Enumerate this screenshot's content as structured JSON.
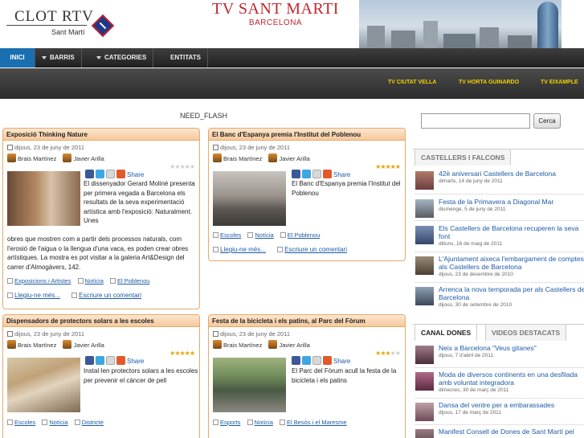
{
  "header": {
    "logo_text": "CLOT RTV",
    "logo_sub": "Sant Martí",
    "site_title": "TV SANT MARTI",
    "site_subtitle": "BARCELONA"
  },
  "nav": {
    "items": [
      {
        "label": "INICI"
      },
      {
        "label": "BARRIS"
      },
      {
        "label": "CATEGORIES"
      },
      {
        "label": "ENTITATS"
      }
    ]
  },
  "subnav": {
    "items": [
      {
        "label": "TV CIUTAT VELLA"
      },
      {
        "label": "TV HORTA GUINARDO"
      },
      {
        "label": "TV EIXAMPLE"
      }
    ]
  },
  "main": {
    "flash_text": "NEED_FLASH",
    "share_label": "Share",
    "read_more": "Llegiu-ne més...",
    "write_comment": "Escriure un comentari",
    "articles": [
      {
        "title": "Exposició Thinking Nature",
        "date": "dijous, 23 de juny de 2011",
        "authors": [
          "Brais Martínez",
          "Javier Arilla"
        ],
        "rating": 0,
        "body_right": "El dissenyador Gerard Moliné presenta per primera vegada a Barcelona els resultats de la seva experimentació artística amb l'exposició: Naturalment. Unes",
        "body_full": "obres que mostren com a partir dels processos naturals, com l'erosió de l'aigua o la llengua d'una vaca, es poden crear obres artístiques. La mostra es pot visitar a la galeria Art&Design del carrer d'Almogàvers, 142.",
        "tags": [
          "Exposicions i Artistes",
          "Notícia",
          "El Poblenou"
        ]
      },
      {
        "title": "El Banc d'Espanya premia l'Institut del Poblenou",
        "date": "dijous, 23 de juny de 2011",
        "authors": [
          "Brais Martínez",
          "Javier Arilla"
        ],
        "rating": 5,
        "body_right": "El Banc d'Espanya premia l'Institut del Poblenou",
        "body_full": "",
        "tags": [
          "Escoles",
          "Notícia",
          "El Poblenou"
        ]
      },
      {
        "title": "Dispensadors de protectors solars a les escoles",
        "date": "dijous, 23 de juny de 2011",
        "authors": [
          "Brais Martínez",
          "Javier Arilla"
        ],
        "rating": 5,
        "body_right": "Instal·len protectors solars a les escoles per prevenir el càncer de pell",
        "body_full": "",
        "tags": [
          "Escoles",
          "Notícia",
          "Districte"
        ]
      },
      {
        "title": "Festa de la bicicleta i els patins, al Parc del Fòrum",
        "date": "dijous, 23 de juny de 2011",
        "authors": [
          "Brais Martínez",
          "Javier Arilla"
        ],
        "rating": 3,
        "body_right": "El Parc del Fòrum acull la festa de la bicicleta i els patins",
        "body_full": "",
        "tags": [
          "Esports",
          "Notícia",
          "El Besòs i el Maresme"
        ]
      }
    ]
  },
  "sidebar": {
    "search_button": "Cerca",
    "search_value": "",
    "castellers_tab": "CASTELLERS I FALCONS",
    "castellers": [
      {
        "title": "42è aniversari Castellers de Barcelona",
        "date": "dimarts, 14 de juny de 2011"
      },
      {
        "title": "Festa de la Primavera a Diagonal Mar",
        "date": "diumenge, 5 de juny de 2011"
      },
      {
        "title": "Els Castellers de Barcelona recuperen la seva font",
        "date": "dilluns, 16 de maig de 2011"
      },
      {
        "title": "L'Ajuntament aixeca l'embargament de comptes als Castellers de Barcelona",
        "date": "dijous, 23 de desembre de 2010"
      },
      {
        "title": "Arrenca la nova temporada per als Castellers de Barcelona",
        "date": "dijous, 30 de setembre de 2010"
      }
    ],
    "tabs2": [
      {
        "label": "CANAL DONES"
      },
      {
        "label": "VIDEOS DESTACATS"
      }
    ],
    "dones": [
      {
        "title": "Neix a Barcelona \"Veus gitanes\"",
        "date": "dijous, 7 d'abril de 2011"
      },
      {
        "title": "Moda de diversos continents en una desfilada amb voluntat integradora",
        "date": "dimecres, 30 de març de 2011"
      },
      {
        "title": "Dansa del ventre per a embarassades",
        "date": "dijous, 17 de març de 2011"
      },
      {
        "title": "Manifest Consell de Dones de Sant Martí pel",
        "date": ""
      }
    ]
  }
}
